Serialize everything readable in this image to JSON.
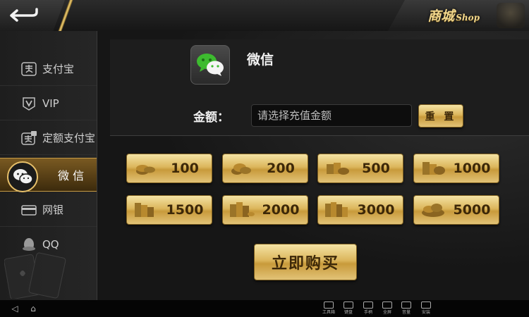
{
  "header": {
    "shop_title_cn": "商城",
    "shop_title_en": "Shop"
  },
  "sidebar": {
    "items": [
      {
        "label": "支付宝",
        "icon": "alipay-icon"
      },
      {
        "label": "VIP",
        "icon": "vip-icon"
      },
      {
        "label": "定额支付宝",
        "icon": "alipay-fixed-icon"
      },
      {
        "label": "微 信",
        "icon": "wechat-icon",
        "active": true
      },
      {
        "label": "网银",
        "icon": "bank-card-icon"
      },
      {
        "label": "QQ",
        "icon": "qq-icon"
      }
    ]
  },
  "payment": {
    "method_title": "微信",
    "amount_label": "金额：",
    "amount_placeholder": "请选择充值金额",
    "reset_label": "重 置"
  },
  "amounts": [
    "100",
    "200",
    "500",
    "1000",
    "1500",
    "2000",
    "3000",
    "5000"
  ],
  "buy_label": "立即购买",
  "navbar": {
    "items": [
      "工具箱",
      "键盘",
      "手柄",
      "全屏",
      "音量",
      "安装"
    ]
  },
  "colors": {
    "gold": "#dcb65c",
    "active_tab": "#7a5a22",
    "wechat_green": "#3dbb2f"
  }
}
